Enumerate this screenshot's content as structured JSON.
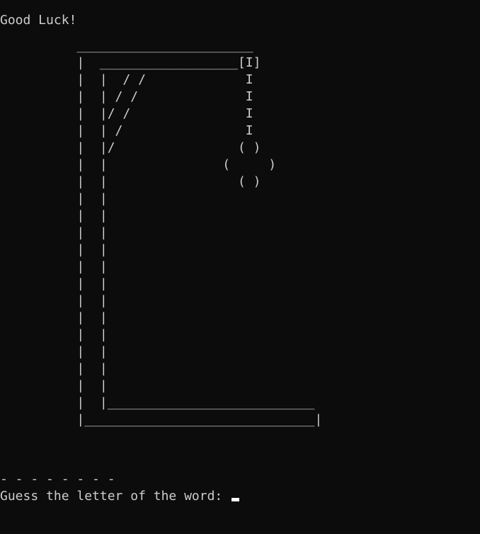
{
  "console": {
    "greeting": "Good Luck!",
    "gallows_rows": [
      "          _______________________",
      "          |  __________________[I]",
      "          |  |  / /             I",
      "          |  | / /              I",
      "          |  |/ /               I",
      "          |  | /                I",
      "          |  |/                ( )",
      "          |  |               (     )",
      "          |  |                 ( )",
      "          |  |",
      "          |  |",
      "          |  |",
      "          |  |",
      "          |  |",
      "          |  |",
      "          |  |",
      "          |  |",
      "          |  |",
      "          |  |",
      "          |  |",
      "          |  |",
      "          |  |___________________________",
      "          |______________________________|"
    ],
    "word_blanks": "- - - - - - - -",
    "prompt": "Guess the letter of the word: "
  }
}
